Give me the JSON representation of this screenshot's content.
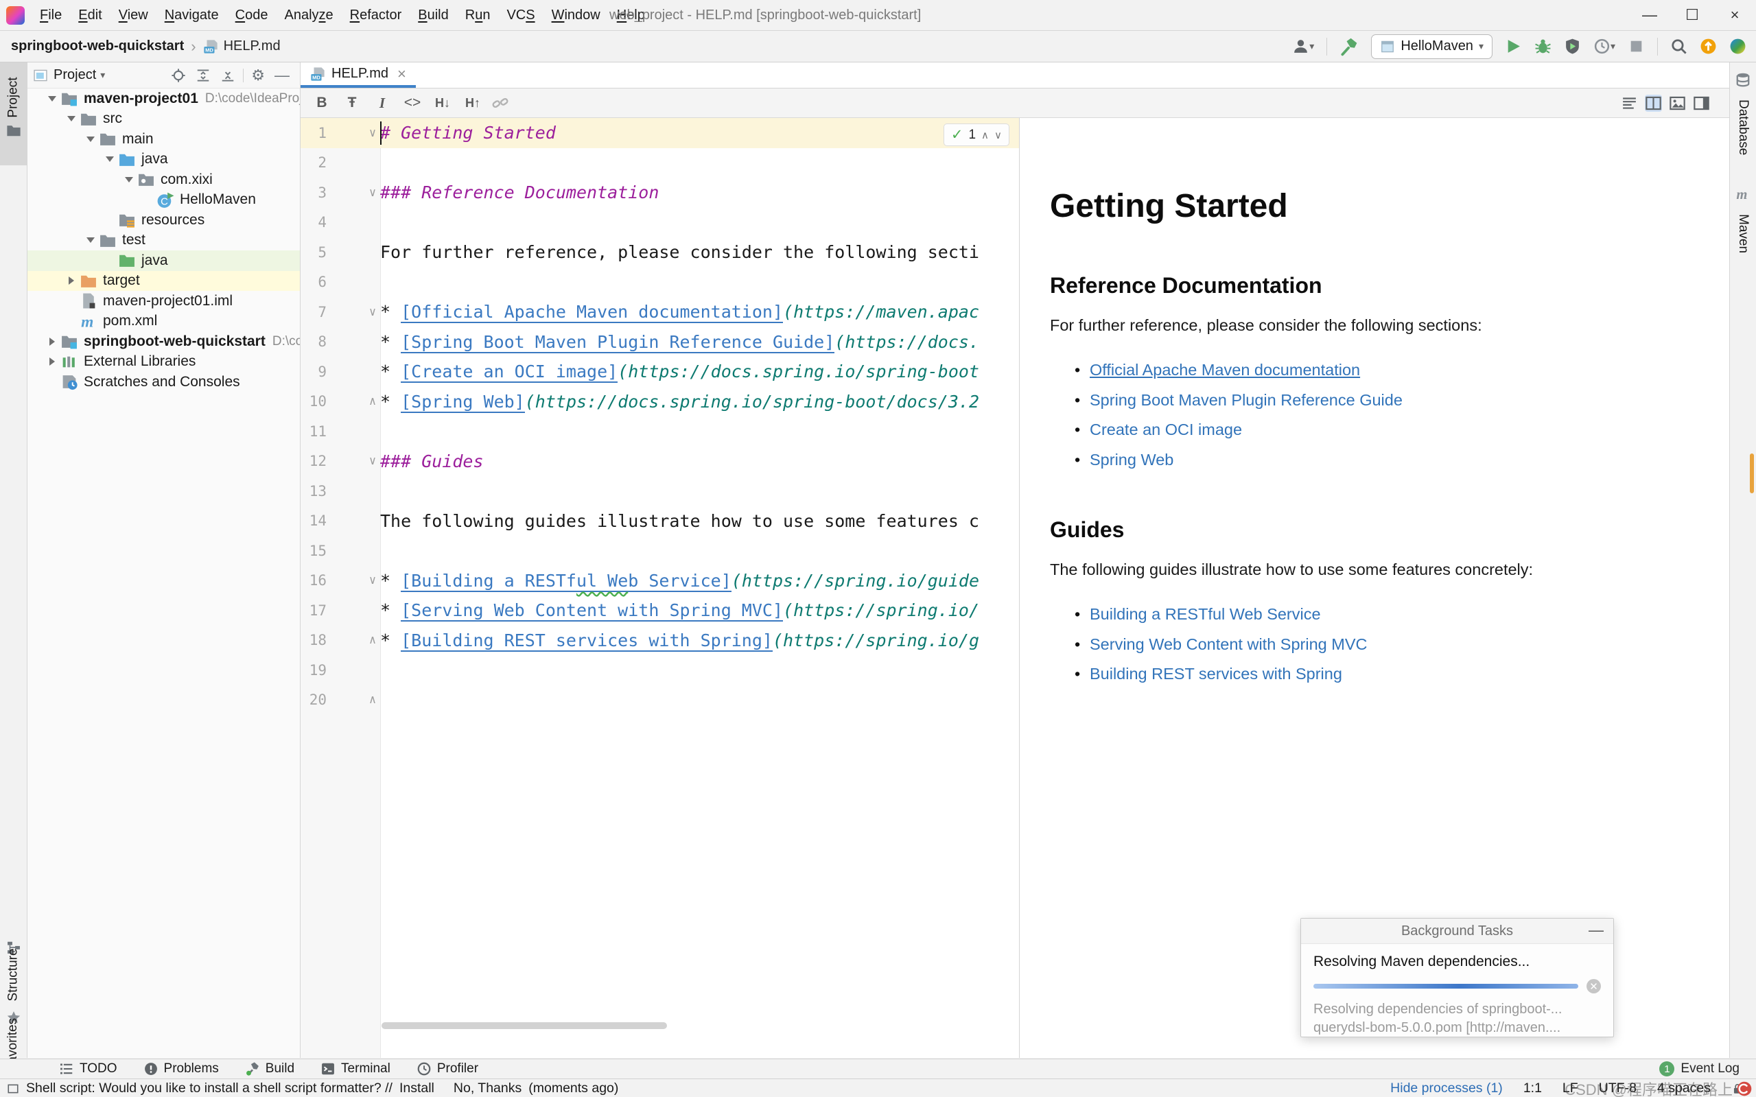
{
  "window": {
    "title": "web_project - HELP.md [springboot-web-quickstart]",
    "controls": {
      "minimize": "—",
      "maximize": "☐",
      "close": "×"
    }
  },
  "menu": {
    "items": [
      {
        "pre": "",
        "key": "F",
        "post": "ile"
      },
      {
        "pre": "",
        "key": "E",
        "post": "dit"
      },
      {
        "pre": "",
        "key": "V",
        "post": "iew"
      },
      {
        "pre": "",
        "key": "N",
        "post": "avigate"
      },
      {
        "pre": "",
        "key": "C",
        "post": "ode"
      },
      {
        "pre": "Analy",
        "key": "z",
        "post": "e"
      },
      {
        "pre": "",
        "key": "R",
        "post": "efactor"
      },
      {
        "pre": "",
        "key": "B",
        "post": "uild"
      },
      {
        "pre": "R",
        "key": "u",
        "post": "n"
      },
      {
        "pre": "VC",
        "key": "S",
        "post": ""
      },
      {
        "pre": "",
        "key": "W",
        "post": "indow"
      },
      {
        "pre": "",
        "key": "H",
        "post": "elp"
      }
    ]
  },
  "breadcrumb": {
    "project": "springboot-web-quickstart",
    "separator": "›",
    "file": "HELP.md"
  },
  "run_toolbar": {
    "config_name": "HelloMaven"
  },
  "left_stripe": {
    "top_tab": "Project",
    "bottom_tabs": [
      {
        "icon": "structure-icon",
        "label": "Structure"
      },
      {
        "icon": "star-icon",
        "label": "Favorites"
      }
    ]
  },
  "right_stripe": {
    "tabs": [
      {
        "icon": "database-icon",
        "label": "Database"
      },
      {
        "icon": "maven-stripe-icon",
        "label": "Maven"
      }
    ]
  },
  "project_panel": {
    "title": "Project",
    "tree": [
      {
        "level": 0,
        "chev": "open",
        "icon": "module-folder",
        "label": "maven-project01",
        "bold": true,
        "path": "D:\\code\\IdeaProjects"
      },
      {
        "level": 1,
        "chev": "open",
        "icon": "folder",
        "label": "src"
      },
      {
        "level": 2,
        "chev": "open",
        "icon": "folder",
        "label": "main"
      },
      {
        "level": 3,
        "chev": "open",
        "icon": "source-folder",
        "label": "java"
      },
      {
        "level": 4,
        "chev": "open",
        "icon": "package-folder",
        "label": "com.xixi"
      },
      {
        "level": 5,
        "chev": "none",
        "icon": "class-run",
        "label": "HelloMaven"
      },
      {
        "level": 3,
        "chev": "none",
        "icon": "resources-folder",
        "label": "resources"
      },
      {
        "level": 2,
        "chev": "open",
        "icon": "folder",
        "label": "test"
      },
      {
        "level": 3,
        "chev": "none",
        "icon": "test-folder",
        "label": "java",
        "bg": "#eef6e2"
      },
      {
        "level": 1,
        "chev": "closed",
        "icon": "excluded-folder",
        "label": "target",
        "bg": "#fffbdc"
      },
      {
        "level": 1,
        "chev": "none",
        "icon": "iml-file",
        "label": "maven-project01.iml"
      },
      {
        "level": 1,
        "chev": "none",
        "icon": "maven-file",
        "label": "pom.xml"
      },
      {
        "level": 0,
        "chev": "closed",
        "icon": "module-folder",
        "label": "springboot-web-quickstart",
        "bold": true,
        "path": "D:\\code\\IdeaProjects"
      },
      {
        "level": 0,
        "chev": "closed",
        "icon": "libraries-icon",
        "label": "External Libraries"
      },
      {
        "level": 0,
        "chev": "none",
        "icon": "scratches-icon",
        "label": "Scratches and Consoles"
      }
    ]
  },
  "editor": {
    "tab_label": "HELP.md",
    "inspection": {
      "check": "✓",
      "count": "1",
      "up": "∧",
      "down": "∨"
    },
    "lines": [
      {
        "n": "1",
        "fold": "start",
        "cur": true,
        "seg": [
          {
            "t": "# Getting Started",
            "c": "header"
          }
        ]
      },
      {
        "n": "2"
      },
      {
        "n": "3",
        "fold": "start",
        "seg": [
          {
            "t": "### Reference Documentation",
            "c": "header"
          }
        ]
      },
      {
        "n": "4"
      },
      {
        "n": "5",
        "seg": [
          {
            "t": "For further reference, please consider the following secti",
            "c": "plain"
          }
        ]
      },
      {
        "n": "6"
      },
      {
        "n": "7",
        "fold": "start",
        "seg": [
          {
            "t": "* ",
            "c": "plain"
          },
          {
            "t": "[Official Apache Maven documentation]",
            "c": "link"
          },
          {
            "t": "(https://maven.apac",
            "c": "url"
          }
        ]
      },
      {
        "n": "8",
        "seg": [
          {
            "t": "* ",
            "c": "plain"
          },
          {
            "t": "[Spring Boot Maven Plugin Reference Guide]",
            "c": "link"
          },
          {
            "t": "(https://docs.",
            "c": "url"
          }
        ]
      },
      {
        "n": "9",
        "seg": [
          {
            "t": "* ",
            "c": "plain"
          },
          {
            "t": "[Create an OCI image]",
            "c": "link"
          },
          {
            "t": "(https://docs.spring.io/spring-boot",
            "c": "url"
          }
        ]
      },
      {
        "n": "10",
        "fold": "end",
        "seg": [
          {
            "t": "* ",
            "c": "plain"
          },
          {
            "t": "[Spring Web]",
            "c": "link"
          },
          {
            "t": "(https://docs.spring.io/spring-boot/docs/3.2",
            "c": "url"
          }
        ]
      },
      {
        "n": "11"
      },
      {
        "n": "12",
        "fold": "start",
        "seg": [
          {
            "t": "### Guides",
            "c": "header"
          }
        ]
      },
      {
        "n": "13"
      },
      {
        "n": "14",
        "seg": [
          {
            "t": "The following guides illustrate how to use some features c",
            "c": "plain"
          }
        ]
      },
      {
        "n": "15"
      },
      {
        "n": "16",
        "fold": "start",
        "seg": [
          {
            "t": "* ",
            "c": "plain"
          },
          {
            "t": "[Building a RESTf",
            "c": "link"
          },
          {
            "t": "ul We",
            "c": "link-typo"
          },
          {
            "t": "b Service]",
            "c": "link"
          },
          {
            "t": "(https://spring.io/guide",
            "c": "url"
          }
        ]
      },
      {
        "n": "17",
        "seg": [
          {
            "t": "* ",
            "c": "plain"
          },
          {
            "t": "[Serving Web Content with Spring MVC]",
            "c": "link"
          },
          {
            "t": "(https://spring.io/",
            "c": "url"
          }
        ]
      },
      {
        "n": "18",
        "fold": "end",
        "seg": [
          {
            "t": "* ",
            "c": "plain"
          },
          {
            "t": "[Building REST services with Spring]",
            "c": "link"
          },
          {
            "t": "(https://spring.io/g",
            "c": "url"
          }
        ]
      },
      {
        "n": "19"
      },
      {
        "n": "20",
        "fold": "end"
      }
    ]
  },
  "preview": {
    "title": "Getting Started",
    "sections": [
      {
        "heading": "Reference Documentation",
        "paragraph": "For further reference, please consider the following sections:",
        "links": [
          {
            "text": "Official Apache Maven documentation",
            "underline": true
          },
          {
            "text": "Spring Boot Maven Plugin Reference Guide"
          },
          {
            "text": "Create an OCI image"
          },
          {
            "text": "Spring Web"
          }
        ]
      },
      {
        "heading": "Guides",
        "paragraph": "The following guides illustrate how to use some features concretely:",
        "links": [
          {
            "text": "Building a RESTful Web Service"
          },
          {
            "text": "Serving Web Content with Spring MVC"
          },
          {
            "text": "Building REST services with Spring"
          }
        ]
      }
    ]
  },
  "background_tasks": {
    "title": "Background Tasks",
    "task": "Resolving Maven dependencies...",
    "progress_percent": 98,
    "detail_line1": "Resolving dependencies of springboot-...",
    "detail_line2": "querydsl-bom-5.0.0.pom [http://maven...."
  },
  "toolwindow_bar": {
    "buttons": [
      {
        "icon": "todo-icon",
        "label": "TODO"
      },
      {
        "icon": "problems-icon",
        "label": "Problems"
      },
      {
        "icon": "build-icon",
        "label": "Build"
      },
      {
        "icon": "terminal-icon",
        "label": "Terminal"
      },
      {
        "icon": "profiler-small-icon",
        "label": "Profiler"
      }
    ],
    "event_log": {
      "badge": "1",
      "label": "Event Log"
    }
  },
  "status_bar": {
    "message": "Shell script: Would you like to install a shell script formatter? // ",
    "action_install": "Install",
    "action_no_thanks": "No, Thanks",
    "suffix": "(moments ago)",
    "hide_processes": "Hide processes (1)",
    "caret": "1:1",
    "line_ending": "LF",
    "encoding": "UTF-8",
    "indent": "4 spaces",
    "watermark": "CSDN @程序喵正在路上"
  },
  "colors": {
    "accent_blue": "#4083c9",
    "editor_link": "#3a79c1",
    "editor_url": "#0d7a70",
    "md_header": "#9c1f9c",
    "preview_link": "#3173b9",
    "run_green": "#59a869",
    "current_line": "#fcf5da",
    "warn_orange": "#e8a33d"
  }
}
